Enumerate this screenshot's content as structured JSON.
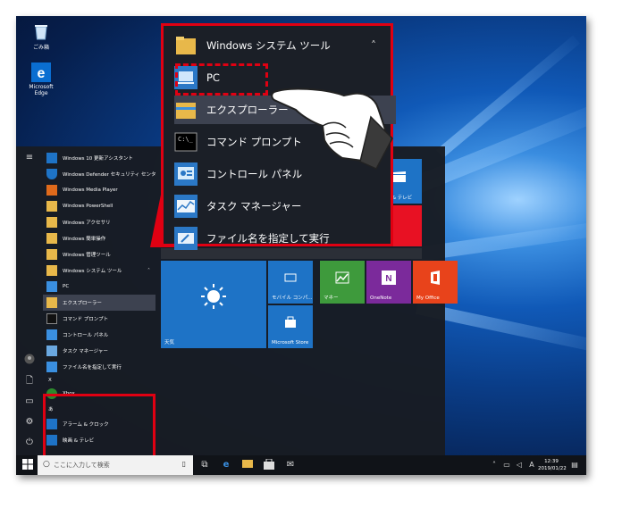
{
  "desktop": {
    "icons": [
      {
        "label": "ごみ箱",
        "icon": "recycle-bin-icon"
      },
      {
        "label": "Microsoft Edge",
        "icon": "edge-icon"
      }
    ]
  },
  "start_menu": {
    "apps": [
      {
        "label": "Windows 10 更新アシスタント",
        "icon": "windows-update-icon"
      },
      {
        "label": "Windows Defender セキュリティ センター",
        "icon": "shield-icon"
      },
      {
        "label": "Windows Media Player",
        "icon": "media-player-icon"
      },
      {
        "label": "Windows PowerShell",
        "icon": "folder-icon"
      },
      {
        "label": "Windows アクセサリ",
        "icon": "folder-icon"
      },
      {
        "label": "Windows 簡単操作",
        "icon": "folder-icon"
      },
      {
        "label": "Windows 管理ツール",
        "icon": "folder-icon"
      }
    ],
    "expanded_group": {
      "label": "Windows システム ツール",
      "items": [
        {
          "label": "PC",
          "icon": "pc-icon"
        },
        {
          "label": "エクスプローラー",
          "icon": "explorer-folder-icon"
        },
        {
          "label": "コマンド プロンプト",
          "icon": "cmd-icon"
        },
        {
          "label": "コントロール パネル",
          "icon": "control-panel-icon"
        },
        {
          "label": "タスク マネージャー",
          "icon": "task-manager-icon"
        },
        {
          "label": "ファイル名を指定して実行",
          "icon": "run-icon"
        }
      ]
    },
    "section_x": "X",
    "xbox": "Xbox",
    "section_a": "あ",
    "alarm": "アラーム & クロック",
    "movies": "映画 & テレビ"
  },
  "tiles": {
    "weather": "天気",
    "mobile": "モバイル コンパ...",
    "store": "Microsoft Store",
    "money": "マネー",
    "onenote": "OneNote",
    "office": "My Office",
    "movies_tv": "映画 & テレビ"
  },
  "zoom_panel": {
    "header": "Windows システム ツール",
    "items": [
      "PC",
      "エクスプローラー",
      "コマンド プロンプト",
      "コントロール パネル",
      "タスク マネージャー",
      "ファイル名を指定して実行"
    ]
  },
  "taskbar": {
    "search_placeholder": "ここに入力して検索",
    "time": "12:39",
    "date": "2019/01/22",
    "ime": "A"
  },
  "colors": {
    "highlight_red": "#e00012",
    "tile_blue": "#1e73c6",
    "money_green": "#3e9a3c",
    "onenote_purple": "#7b2a9b",
    "office_red": "#e8431b"
  }
}
